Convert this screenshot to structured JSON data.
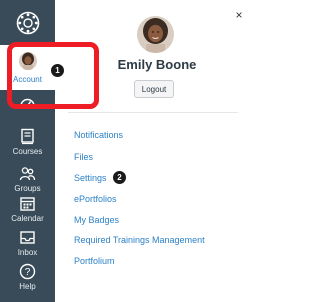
{
  "nav_rail": {
    "logo_icon": "canvas-logo-icon",
    "account_label": "Account",
    "items": [
      {
        "label": "",
        "icon": "dashboard-icon"
      },
      {
        "label": "Courses",
        "icon": "courses-icon"
      },
      {
        "label": "Groups",
        "icon": "groups-icon"
      },
      {
        "label": "Calendar",
        "icon": "calendar-icon"
      },
      {
        "label": "Inbox",
        "icon": "inbox-icon"
      },
      {
        "label": "Help",
        "icon": "help-icon"
      }
    ]
  },
  "tray": {
    "close_glyph": "×",
    "user_name": "Emily Boone",
    "logout_label": "Logout",
    "links": [
      {
        "label": "Notifications"
      },
      {
        "label": "Files"
      },
      {
        "label": "Settings"
      },
      {
        "label": "ePortfolios"
      },
      {
        "label": "My Badges"
      },
      {
        "label": "Required Trainings Management"
      },
      {
        "label": "Portfolium"
      }
    ]
  },
  "annotations": {
    "step_1": "1",
    "step_2": "2",
    "highlight_color": "#EE1C25"
  },
  "colors": {
    "rail_bg": "#394B58",
    "link": "#2D81C6",
    "text": "#2D3B45"
  }
}
